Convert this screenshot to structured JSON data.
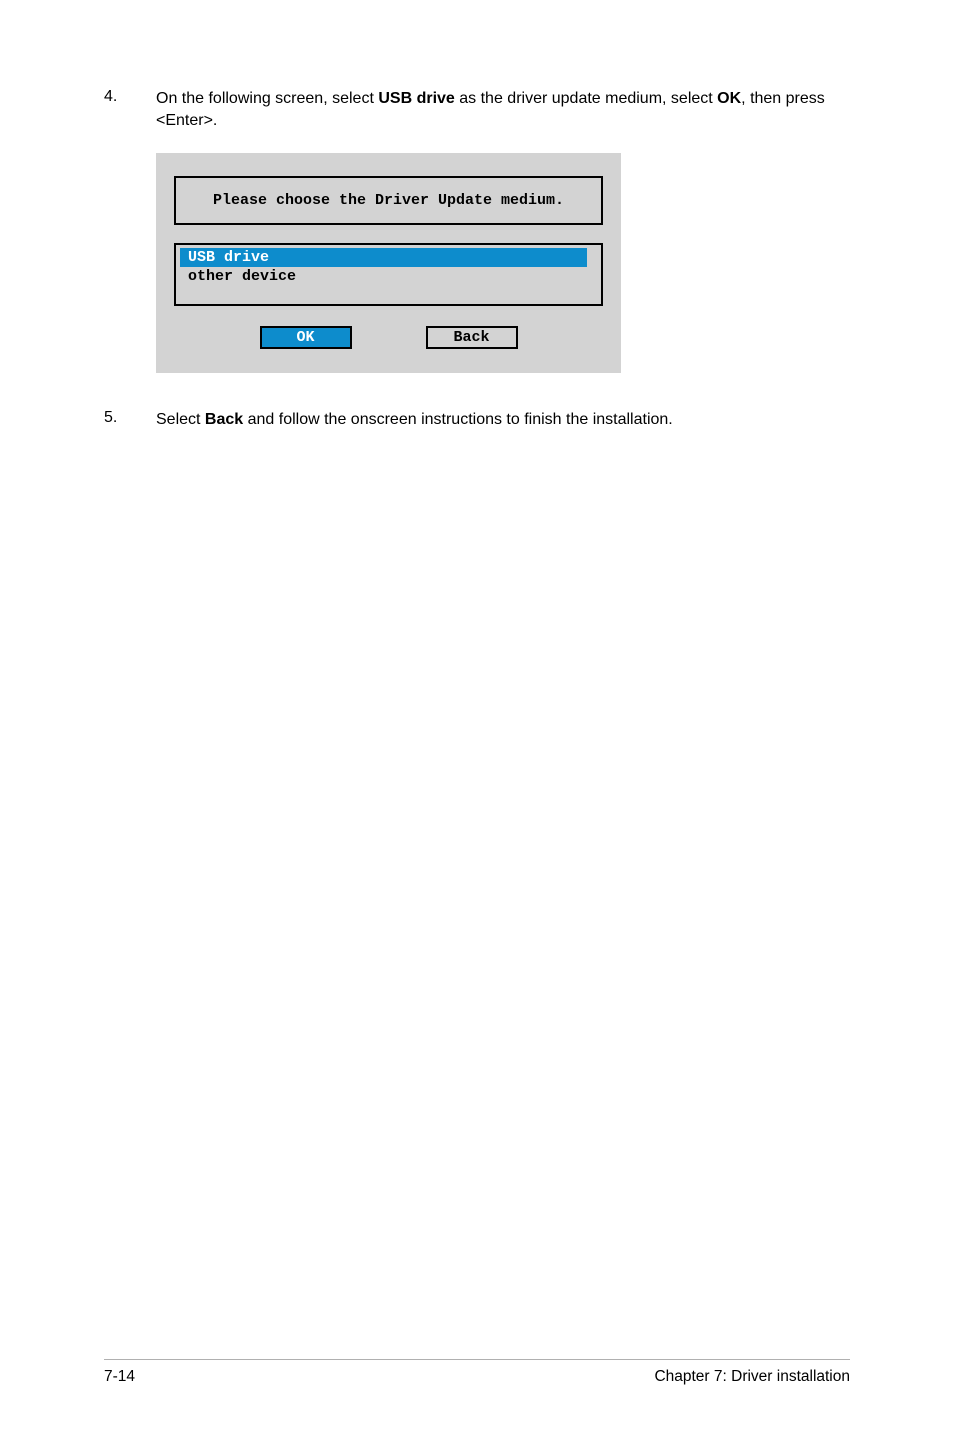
{
  "step4": {
    "num": "4.",
    "text_1": "On the following screen, select ",
    "bold_1": "USB drive",
    "text_2": " as the driver update medium, select ",
    "bold_2": "OK",
    "text_3": ", then press <Enter>."
  },
  "dialog": {
    "title": "Please choose the Driver Update medium.",
    "items": [
      "USB drive",
      "other device"
    ],
    "ok_label": "OK",
    "back_label": "Back"
  },
  "step5": {
    "num": "5.",
    "text_1": "Select ",
    "bold_1": "Back",
    "text_2": " and follow the onscreen instructions to finish the installation."
  },
  "footer": {
    "page": "7-14",
    "chapter": "Chapter 7: Driver installation"
  }
}
